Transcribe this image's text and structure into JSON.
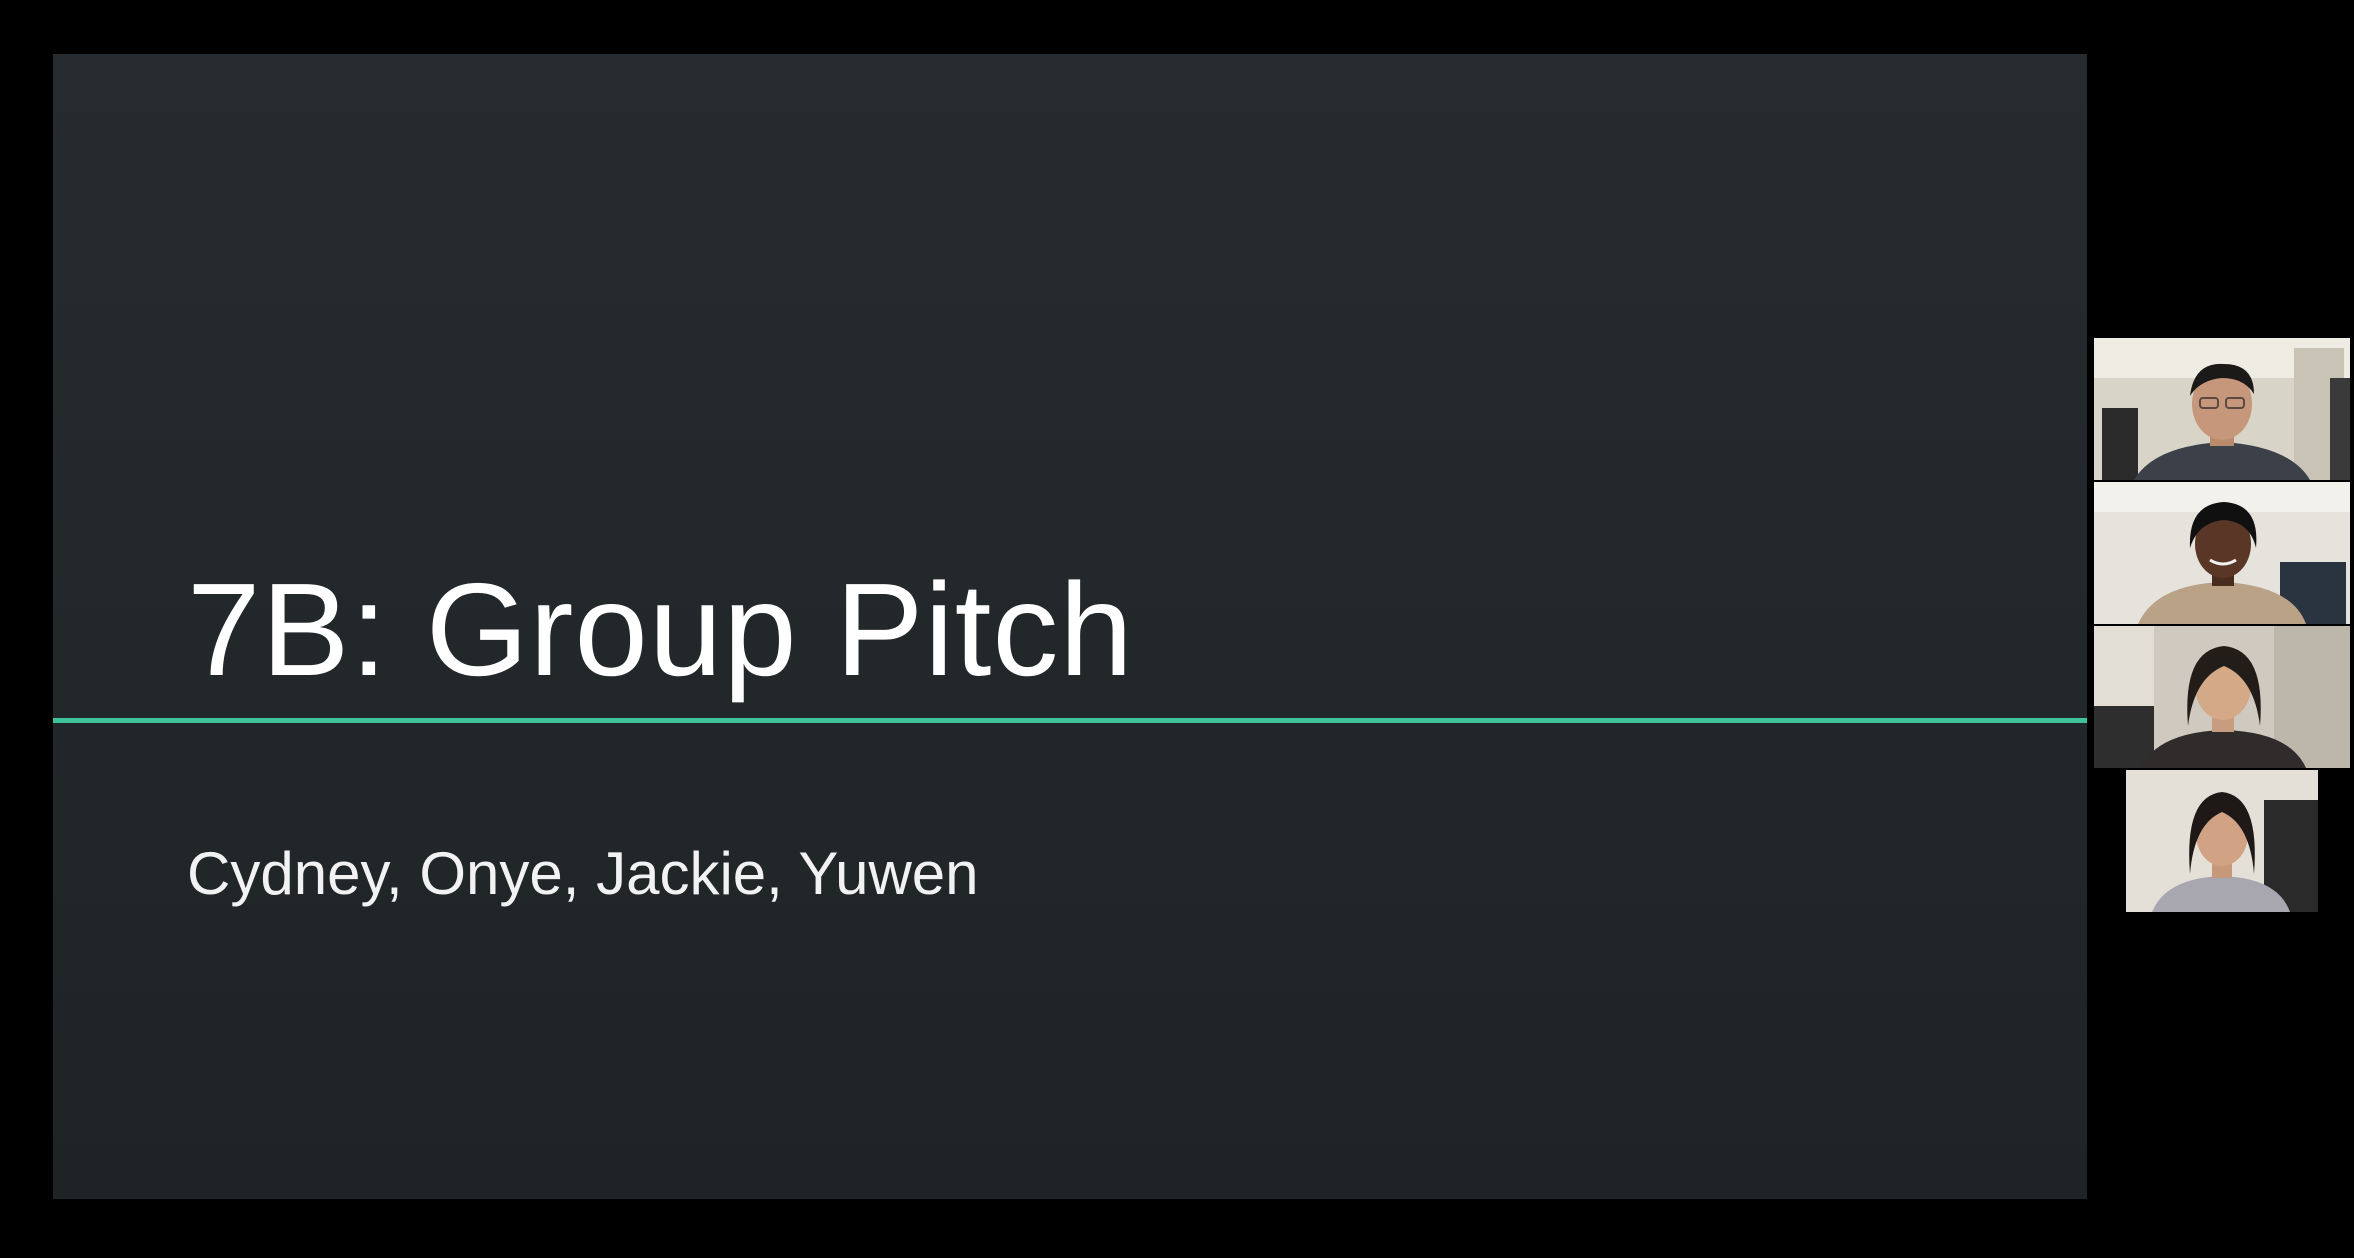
{
  "slide": {
    "title": "7B: Group Pitch",
    "subtitle": "Cydney, Onye, Jackie, Yuwen",
    "accent_color": "#3fc49a",
    "background_color": "#23282b"
  },
  "participants": [
    {
      "id": "participant-1"
    },
    {
      "id": "participant-2"
    },
    {
      "id": "participant-3"
    },
    {
      "id": "participant-4"
    }
  ]
}
